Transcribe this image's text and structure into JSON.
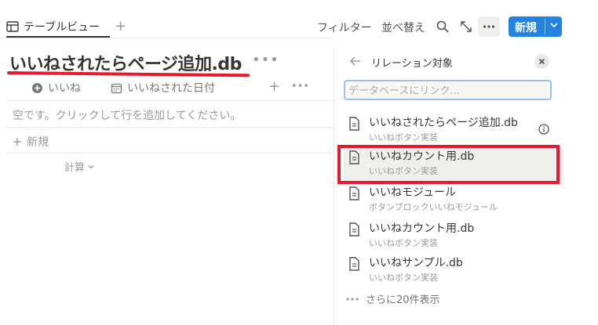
{
  "tabs": {
    "active_label": "テーブルビュー",
    "add": "+"
  },
  "toolbar": {
    "filter_label": "フィルター",
    "sort_label": "並べ替え",
    "more_label": "•••",
    "new_label": "新規"
  },
  "page": {
    "title": "いいねされたらページ追加.db",
    "title_more": "•••"
  },
  "columns": [
    {
      "label": "いいね",
      "icon": "plus-circle-icon"
    },
    {
      "label": "いいねされた日付",
      "icon": "calendar-icon"
    }
  ],
  "column_actions": {
    "add": "+",
    "more": "•••"
  },
  "table": {
    "empty_text": "空です。クリックして行を追加してください。",
    "new_row_label": "新規",
    "calc_label": "計算"
  },
  "relation_panel": {
    "title": "リレーション対象",
    "search_placeholder": "データベースにリンク...",
    "items": [
      {
        "name": "いいねされたらページ追加.db",
        "sub": "いいねボタン実装"
      },
      {
        "name": "いいねカウント用.db",
        "sub": "いいねボタン実装"
      },
      {
        "name": "いいねモジュール",
        "sub": "ボタンブロックいいねモジュール"
      },
      {
        "name": "いいねカウント用.db",
        "sub": "いいねボタン実装"
      },
      {
        "name": "いいねサンプル.db",
        "sub": "いいねボタン実装"
      }
    ],
    "show_more": "さらに20件表示"
  },
  "colors": {
    "accent": "#2383e2",
    "highlight": "#e8192c"
  }
}
